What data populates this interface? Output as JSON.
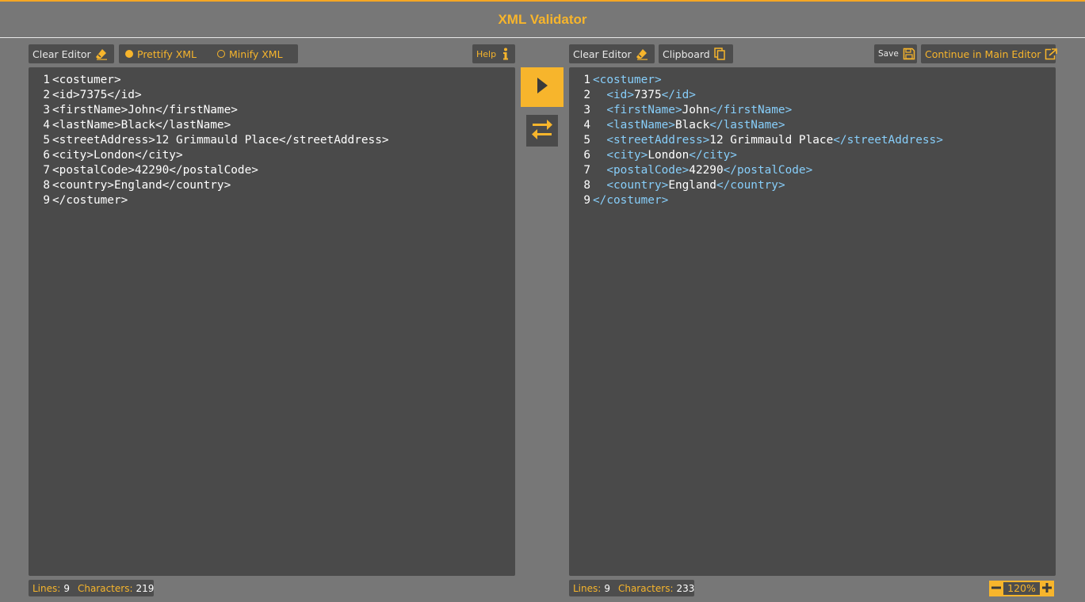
{
  "title": "XML Validator",
  "left_toolbar": {
    "clear_label": "Clear Editor",
    "prettify_label": "Prettify XML",
    "minify_label": "Minify XML",
    "selected_mode": "Prettify XML",
    "help_label": "Help"
  },
  "right_toolbar": {
    "clear_label": "Clear Editor",
    "clipboard_label": "Clipboard",
    "save_label": "Save",
    "continue_label": "Continue in Main Editor"
  },
  "input_editor": {
    "lines": [
      {
        "n": "1",
        "text": "<costumer>"
      },
      {
        "n": "2",
        "text": "<id>7375</id>"
      },
      {
        "n": "3",
        "text": "<firstName>John</firstName>"
      },
      {
        "n": "4",
        "text": "<lastName>Black</lastName>"
      },
      {
        "n": "5",
        "text": "<streetAddress>12 Grimmauld Place</streetAddress>"
      },
      {
        "n": "6",
        "text": "<city>London</city>"
      },
      {
        "n": "7",
        "text": "<postalCode>42290</postalCode>"
      },
      {
        "n": "8",
        "text": "<country>England</country>"
      },
      {
        "n": "9",
        "text": "</costumer>"
      }
    ]
  },
  "output_editor": {
    "lines": [
      {
        "n": "1",
        "indent": "",
        "open": "<costumer>",
        "value": "",
        "close": ""
      },
      {
        "n": "2",
        "indent": "  ",
        "open": "<id>",
        "value": "7375",
        "close": "</id>"
      },
      {
        "n": "3",
        "indent": "  ",
        "open": "<firstName>",
        "value": "John",
        "close": "</firstName>"
      },
      {
        "n": "4",
        "indent": "  ",
        "open": "<lastName>",
        "value": "Black",
        "close": "</lastName>"
      },
      {
        "n": "5",
        "indent": "  ",
        "open": "<streetAddress>",
        "value": "12 Grimmauld Place",
        "close": "</streetAddress>"
      },
      {
        "n": "6",
        "indent": "  ",
        "open": "<city>",
        "value": "London",
        "close": "</city>"
      },
      {
        "n": "7",
        "indent": "  ",
        "open": "<postalCode>",
        "value": "42290",
        "close": "</postalCode>"
      },
      {
        "n": "8",
        "indent": "  ",
        "open": "<country>",
        "value": "England",
        "close": "</country>"
      },
      {
        "n": "9",
        "indent": "",
        "open": "</costumer>",
        "value": "",
        "close": ""
      }
    ]
  },
  "left_status": {
    "lines_label": "Lines:",
    "lines_value": "9",
    "chars_label": "Characters:",
    "chars_value": "219"
  },
  "right_status": {
    "lines_label": "Lines:",
    "lines_value": "9",
    "chars_label": "Characters:",
    "chars_value": "233"
  },
  "zoom": {
    "value": "120%"
  },
  "colors": {
    "accent": "#f7b52c",
    "panel": "#4a4a4a",
    "background": "#777777",
    "tag": "#87cefa"
  },
  "icons": [
    "eraser-icon",
    "info-icon",
    "copy-icon",
    "save-icon",
    "export-icon",
    "play-icon",
    "swap-icon",
    "minus-icon",
    "plus-icon"
  ]
}
